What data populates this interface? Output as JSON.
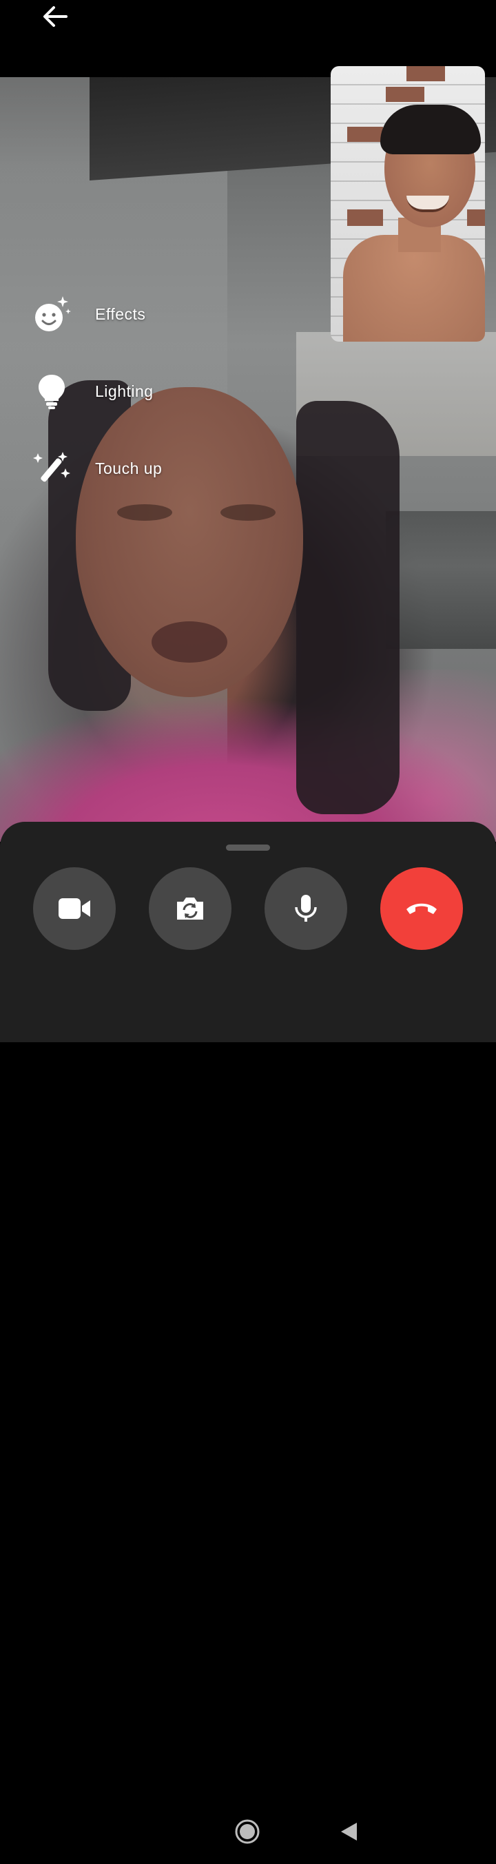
{
  "app": {
    "colors": {
      "sheet_background": "#202020",
      "control_button": "#474747",
      "end_call": "#f2403a",
      "text": "#ffffff"
    }
  },
  "header": {
    "back_icon": "arrow-left-icon"
  },
  "effects_menu": {
    "items": [
      {
        "label": "Effects",
        "icon": "smiley-sparkle-icon"
      },
      {
        "label": "Lighting",
        "icon": "lightbulb-icon"
      },
      {
        "label": "Touch up",
        "icon": "magic-wand-icon"
      }
    ]
  },
  "call_controls": {
    "buttons": [
      {
        "icon": "video-camera-icon"
      },
      {
        "icon": "flip-camera-icon"
      },
      {
        "icon": "microphone-icon"
      },
      {
        "icon": "end-call-icon"
      }
    ]
  },
  "system_nav": {
    "home_icon": "home-circle-icon",
    "back_icon": "triangle-back-icon"
  }
}
